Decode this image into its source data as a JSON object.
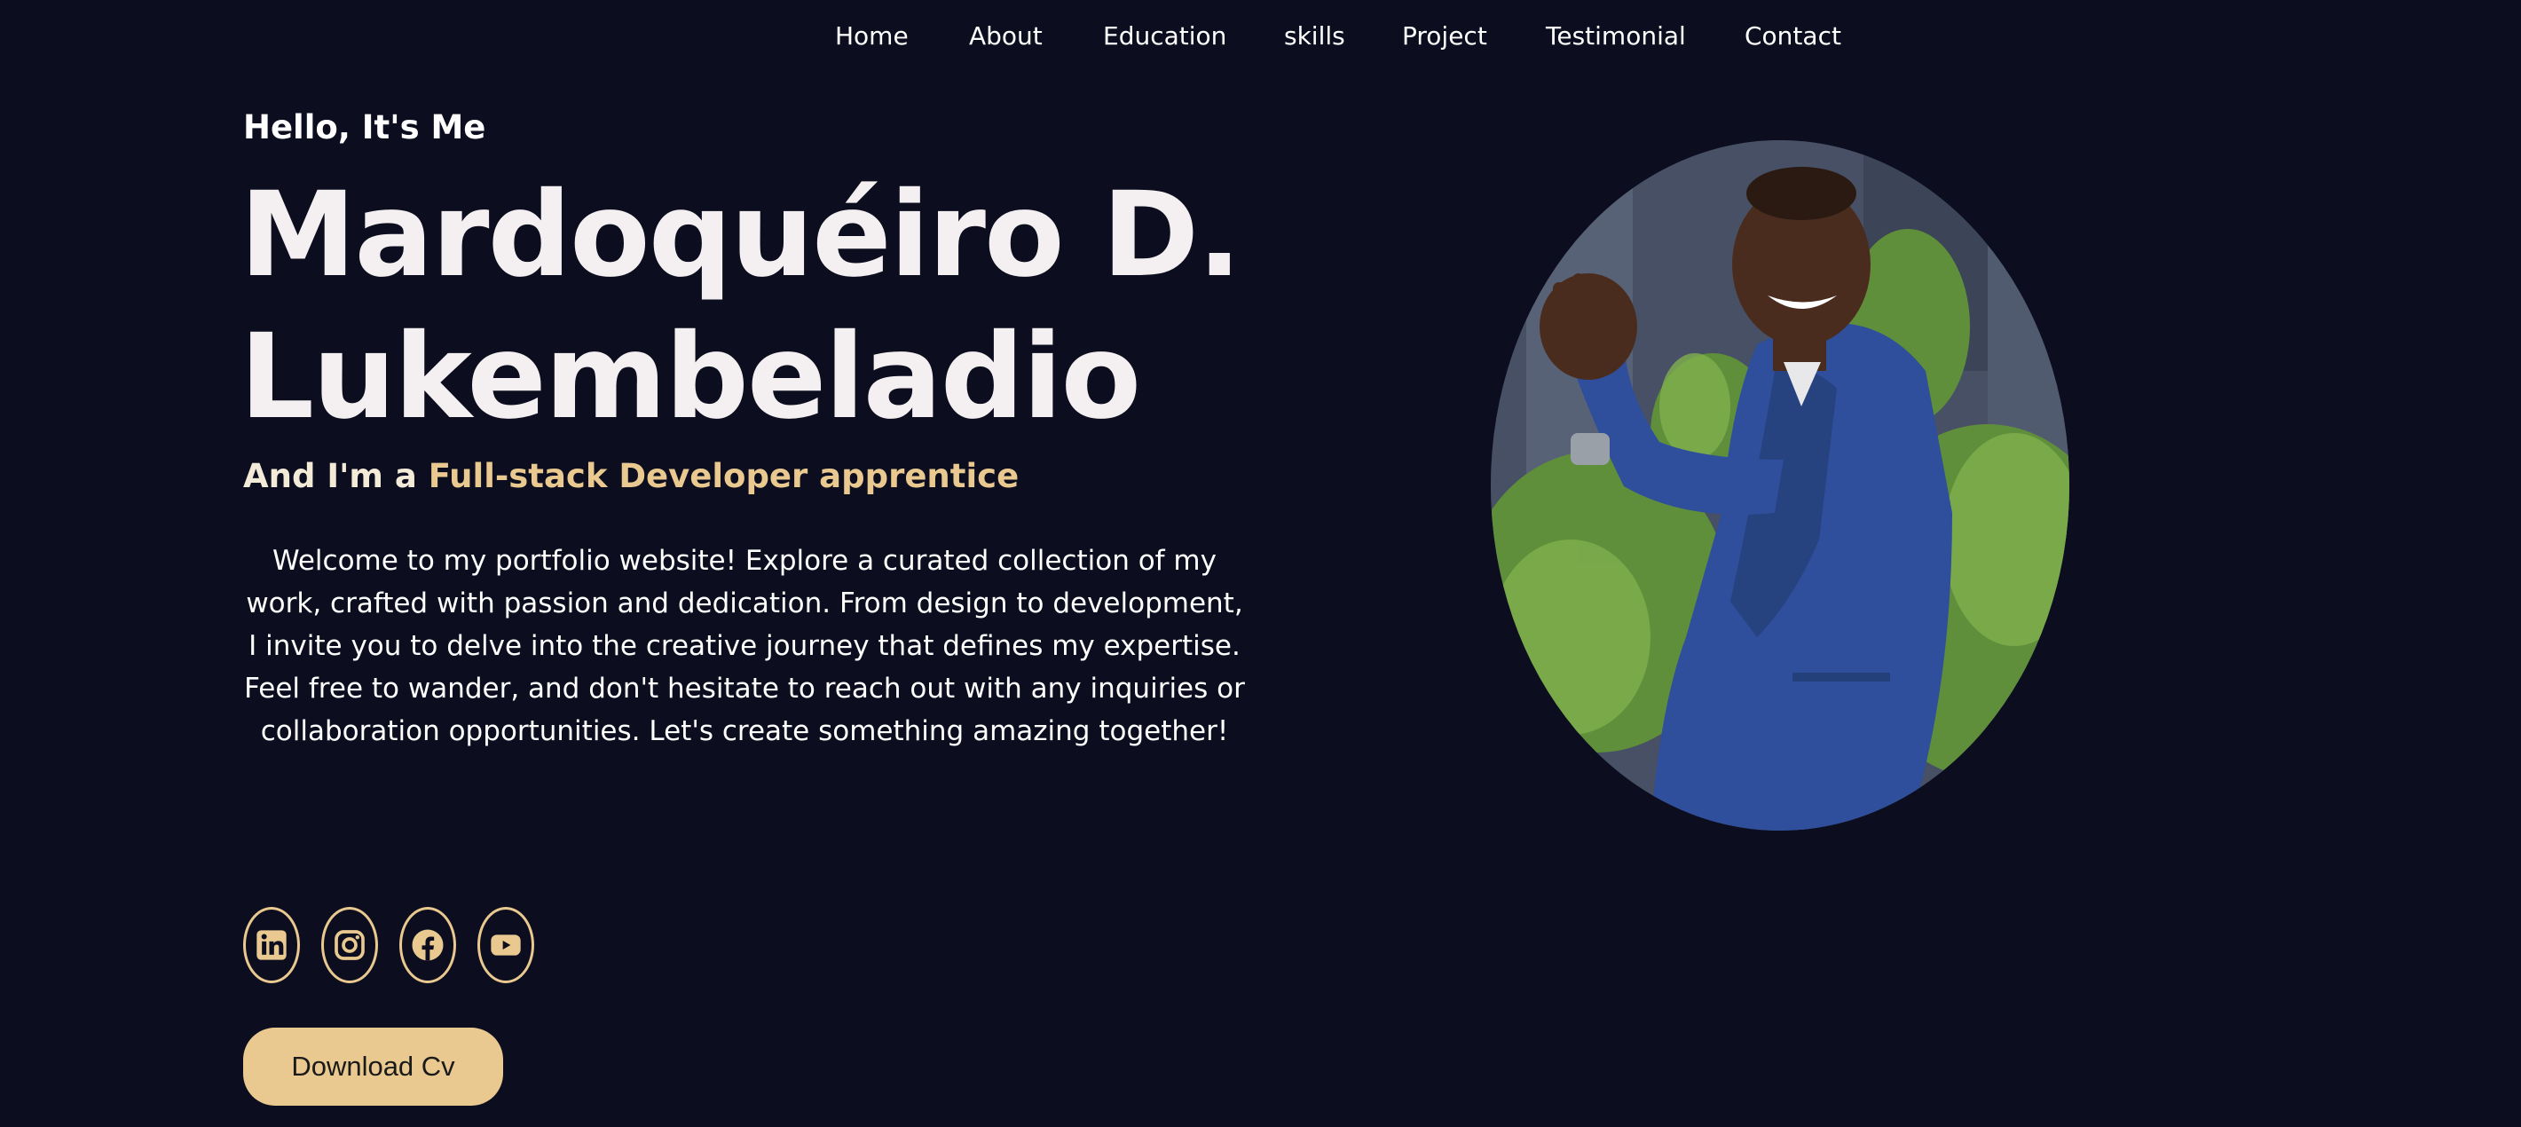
{
  "nav": {
    "items": [
      {
        "label": "Home"
      },
      {
        "label": "About"
      },
      {
        "label": "Education"
      },
      {
        "label": "skills"
      },
      {
        "label": "Project"
      },
      {
        "label": "Testimonial"
      },
      {
        "label": "Contact"
      }
    ]
  },
  "hero": {
    "greeting": "Hello, It's Me",
    "name_line1": "Mardoquéiro D.",
    "name_line2": "Lukembeladio",
    "role_prefix": "And I'm a ",
    "role_highlight": "Full-stack Developer apprentice",
    "intro": "Welcome to my portfolio website! Explore a curated collection of my work, crafted with passion and dedication. From design to development, I invite you to delve into the creative journey that defines my expertise. Feel free to wander, and don't hesitate to reach out with any inquiries or collaboration opportunities. Let's create something amazing together!"
  },
  "social": {
    "items": [
      {
        "icon": "linkedin-icon"
      },
      {
        "icon": "instagram-icon"
      },
      {
        "icon": "facebook-icon"
      },
      {
        "icon": "youtube-icon"
      }
    ]
  },
  "cv": {
    "label": "Download Cv"
  },
  "colors": {
    "background": "#0c0e1f",
    "accent": "#e9c98f",
    "name": "#f4eff0",
    "text": "#ffffff"
  }
}
